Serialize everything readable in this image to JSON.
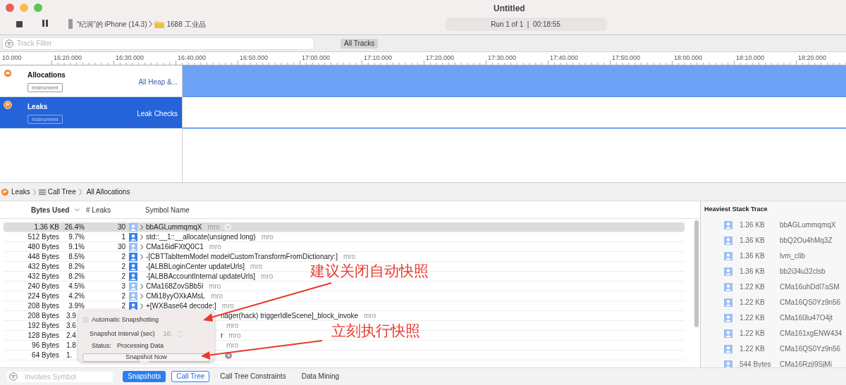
{
  "window": {
    "title": "Untitled",
    "device": "“纪润”的 iPhone (14.3)",
    "app": "1688 工业品",
    "run_status": "Run 1 of 1  |  00:18:55"
  },
  "track_filter": {
    "placeholder": "Track Filter",
    "scope_button": "All Tracks"
  },
  "ruler": [
    "10.000",
    "16:20.000",
    "16:30.000",
    "16:40.000",
    "16:50.000",
    "17:00.000",
    "17:10.000",
    "17:20.000",
    "17:30.000",
    "17:40.000",
    "17:50.000",
    "18:00.000",
    "18:10.000",
    "18:20.000"
  ],
  "tracks": [
    {
      "name": "Allocations",
      "tag": "Instrument",
      "detail": "All Heap &...",
      "selected": false,
      "filled": true
    },
    {
      "name": "Leaks",
      "tag": "Instrument",
      "detail": "Leak Checks",
      "selected": true,
      "filled": false
    }
  ],
  "breadcrumb": [
    {
      "kind": "instrument",
      "label": "Leaks"
    },
    {
      "kind": "list",
      "label": "Call Tree"
    },
    {
      "kind": "plain",
      "label": "All Allocations"
    }
  ],
  "table": {
    "columns": [
      "Bytes Used",
      "# Leaks",
      "Symbol Name"
    ],
    "rows": [
      {
        "bytes": "1.36 KB",
        "percent": "26.4%",
        "leaks": "30",
        "dimmed": true,
        "expandable": true,
        "symbol": "bbAGLummqmqX",
        "library": "mro",
        "selected": true,
        "go_button": true,
        "covered": false
      },
      {
        "bytes": "512 Bytes",
        "percent": "9.7%",
        "leaks": "1",
        "dimmed": false,
        "expandable": true,
        "symbol": "std::__1::__allocate(unsigned long)",
        "library": "mro",
        "selected": false,
        "go_button": false,
        "covered": false
      },
      {
        "bytes": "480 Bytes",
        "percent": "9.1%",
        "leaks": "30",
        "dimmed": true,
        "expandable": true,
        "symbol": "CMa16idFXtQ0C1",
        "library": "mro",
        "selected": false,
        "go_button": false,
        "covered": false
      },
      {
        "bytes": "448 Bytes",
        "percent": "8.5%",
        "leaks": "2",
        "dimmed": false,
        "expandable": true,
        "symbol": "-[CBTTabItemModel modelCustomTransformFromDictionary:]",
        "library": "mro",
        "selected": false,
        "go_button": false,
        "covered": false
      },
      {
        "bytes": "432 Bytes",
        "percent": "8.2%",
        "leaks": "2",
        "dimmed": false,
        "expandable": false,
        "symbol": "-[ALBBLoginCenter updateUrls]",
        "library": "mro",
        "selected": false,
        "go_button": false,
        "covered": false
      },
      {
        "bytes": "432 Bytes",
        "percent": "8.2%",
        "leaks": "2",
        "dimmed": false,
        "expandable": false,
        "symbol": "-[ALBBAccountInternal updateUrls]",
        "library": "mro",
        "selected": false,
        "go_button": false,
        "covered": false
      },
      {
        "bytes": "240 Bytes",
        "percent": "4.5%",
        "leaks": "3",
        "dimmed": true,
        "expandable": true,
        "symbol": "CMa168ZovSBb5l",
        "library": "mro",
        "selected": false,
        "go_button": false,
        "covered": false
      },
      {
        "bytes": "224 Bytes",
        "percent": "4.2%",
        "leaks": "2",
        "dimmed": true,
        "expandable": true,
        "symbol": "CMi18yyOXkAMsL",
        "library": "mro",
        "selected": false,
        "go_button": false,
        "covered": false
      },
      {
        "bytes": "208 Bytes",
        "percent": "3.9%",
        "leaks": "2",
        "dimmed": false,
        "expandable": true,
        "symbol": "+[WXBase64 decode:]",
        "library": "mro",
        "selected": false,
        "go_button": false,
        "covered": false
      },
      {
        "bytes": "208 Bytes",
        "percent": "3.9",
        "symbol": "nager(hack) triggerIdleScene]_block_invoke",
        "library": "mro",
        "selected": false,
        "go_button": false,
        "covered": true
      },
      {
        "bytes": "192 Bytes",
        "percent": "3.6",
        "library": "mro",
        "selected": false,
        "go_button": false,
        "covered": true
      },
      {
        "bytes": "128 Bytes",
        "percent": "2.4",
        "symbol": "r",
        "library": "mro",
        "selected": false,
        "go_button": false,
        "covered": true
      },
      {
        "bytes": "96 Bytes",
        "percent": "1.8",
        "library": "mro",
        "selected": false,
        "go_button": false,
        "covered": true
      },
      {
        "bytes": "64 Bytes",
        "percent": "1.",
        "selected": false,
        "go_button": true,
        "covered": true
      }
    ]
  },
  "heaviest_stack_trace": {
    "title": "Heaviest Stack Trace",
    "frames": [
      {
        "size": "1.36 KB",
        "symbol": "bbAGLummqmqX"
      },
      {
        "size": "1.36 KB",
        "symbol": "bbQ2Ou4hMq3Z"
      },
      {
        "size": "1.36 KB",
        "symbol": "lvm_clib"
      },
      {
        "size": "1.36 KB",
        "symbol": "bb2i34u32clsb"
      },
      {
        "size": "1.22 KB",
        "symbol": "CMa16uhDdl7aSM"
      },
      {
        "size": "1.22 KB",
        "symbol": "CMa16QS0Yz9n56"
      },
      {
        "size": "1.22 KB",
        "symbol": "CMa160lu47O4jt"
      },
      {
        "size": "1.22 KB",
        "symbol": "CMa161xgENW434"
      },
      {
        "size": "1.22 KB",
        "symbol": "CMa16QS0Yz9n56"
      },
      {
        "size": "544 Bytes",
        "symbol": "CMa16Rzji9SjMi"
      }
    ]
  },
  "snapshot_popover": {
    "auto": {
      "label": "Automatic Snapshotting",
      "checked": false
    },
    "interval": {
      "label": "Snapshot Interval (sec)",
      "value": "10.",
      "disabled": true
    },
    "status": {
      "label": "Status:",
      "value": "Processing Data"
    },
    "button": "Snapshot Now"
  },
  "bottom_bar": {
    "filter_placeholder": "Involves Symbol",
    "tabs": [
      {
        "label": "Snapshots",
        "open": true,
        "selected": false
      },
      {
        "label": "Call Tree",
        "open": false,
        "selected": true
      },
      {
        "label": "Call Tree Constraints",
        "open": false,
        "selected": false
      },
      {
        "label": "Data Mining",
        "open": false,
        "selected": false
      }
    ]
  },
  "annotations": [
    "建议关闭自动快照",
    "立刻执行快照"
  ]
}
